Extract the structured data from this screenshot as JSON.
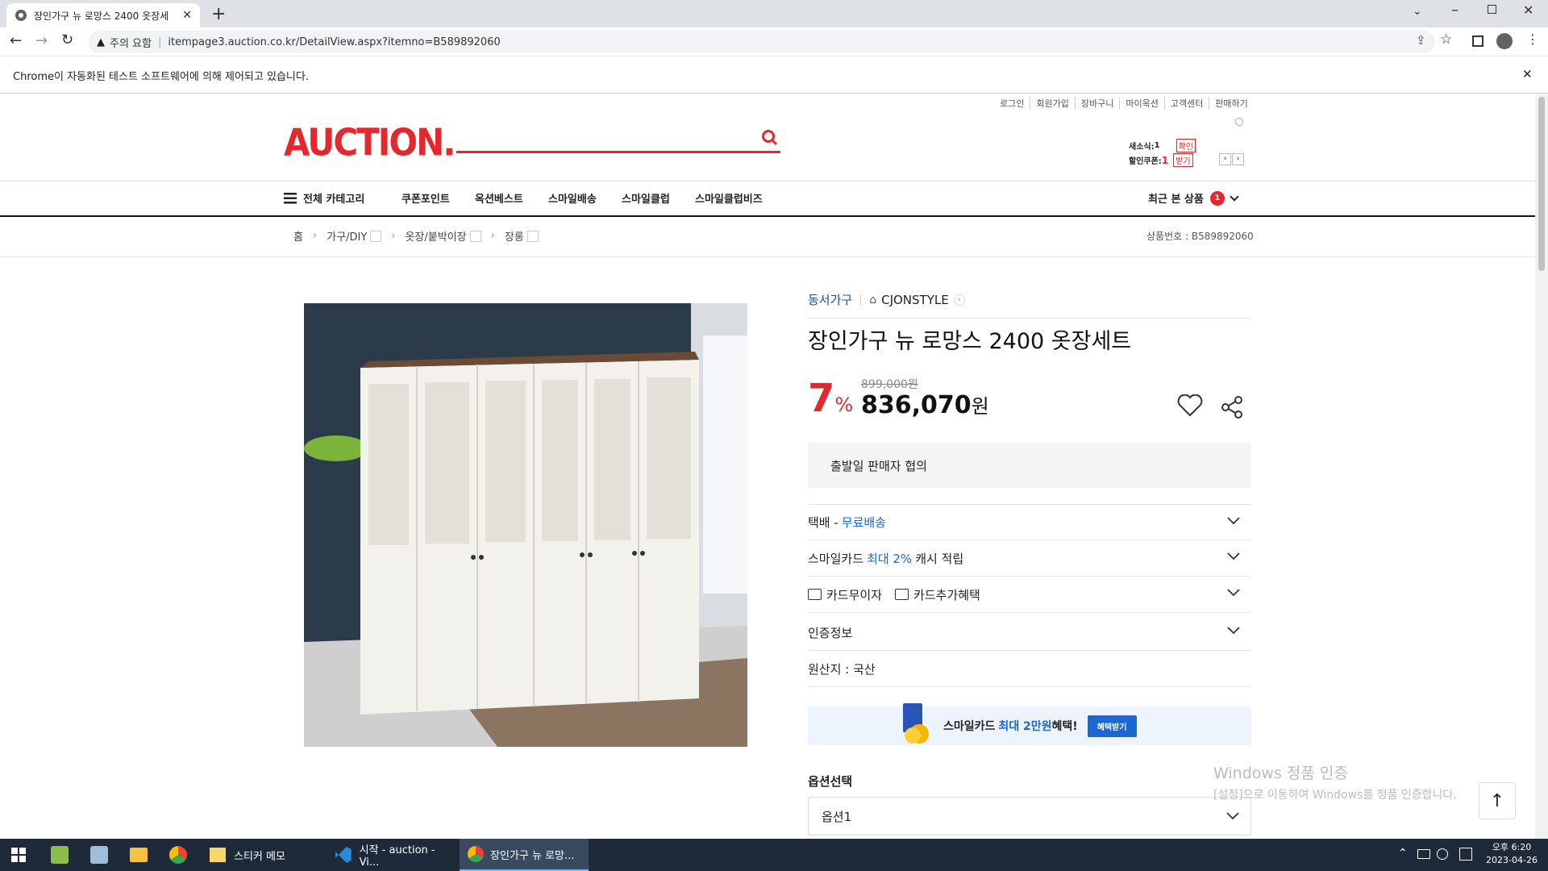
{
  "browser": {
    "tab_title": "장인가구 뉴 로망스 2400 옷장세",
    "security_label": "주의 요함",
    "url": "itempage3.auction.co.kr/DetailView.aspx?itemno=B589892060",
    "infobar_text": "Chrome이 자동화된 테스트 소프트웨어에 의해 제어되고 있습니다."
  },
  "header": {
    "logo": "AUCTION.",
    "util_links": [
      "로그인",
      "회원가입",
      "장바구니",
      "마이옥션",
      "고객센터",
      "판매하기"
    ],
    "coupon1_label": "새소식:",
    "coupon1_count": "1",
    "coupon1_btn": "확인",
    "coupon2_label": "할인쿠폰:",
    "coupon2_count": "1",
    "coupon2_btn": "받기"
  },
  "gnb": {
    "all_category": "전체 카테고리",
    "items": [
      "쿠폰포인트",
      "옥션베스트",
      "스마일배송",
      "스마일클럽",
      "스마일클럽비즈"
    ],
    "recent_label": "최근 본 상품",
    "recent_count": "1"
  },
  "breadcrumb": {
    "home": "홈",
    "cat1": "가구/DIY",
    "cat2": "옷장/붙박이장",
    "cat3": "장롱",
    "item_no": "상품번호 : B589892060"
  },
  "product": {
    "seller": "동서가구",
    "store": "CJONSTYLE",
    "title": "장인가구 뉴 로망스 2400 옷장세트",
    "discount": "7",
    "discount_unit": "%",
    "original_price": "899,000원",
    "price": "836,070",
    "price_unit": "원",
    "ship_note": "출발일 판매자 협의",
    "delivery_label": "택배 - ",
    "delivery_value": "무료배송",
    "smilecard_prefix": "스마일카드 ",
    "smilecard_highlight": "최대 2%",
    "smilecard_suffix": " 캐시 적립",
    "card_installment": "카드무이자",
    "card_benefit": "카드추가혜택",
    "certification": "인증정보",
    "origin": "원산지 : 국산",
    "banner_prefix": "스마일카드 ",
    "banner_highlight": "최대 2만원",
    "banner_suffix": " 혜택!",
    "banner_button": "혜택받기",
    "option_title": "옵션선택",
    "option_value": "옵션1"
  },
  "watermark": {
    "line1": "Windows 정품 인증",
    "line2": "[설정]으로 이동하여 Windows를 정품 인증합니다."
  },
  "taskbar": {
    "items": [
      "스티커 메모",
      "시작 - auction - Vi...",
      "장인가구 뉴 로망..."
    ],
    "time": "오후 6:20",
    "date": "2023-04-26"
  }
}
